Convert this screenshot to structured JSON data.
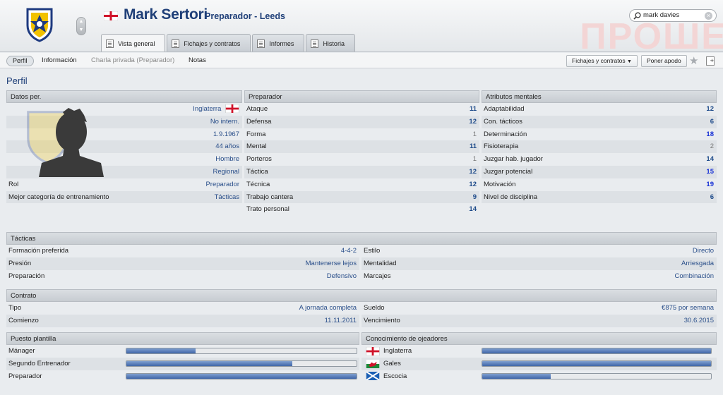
{
  "header": {
    "name": "Mark Sertori",
    "subtitle": "Preparador - Leeds",
    "watermark": "ПРОШЕ",
    "search_value": "mark davies",
    "tabs": [
      {
        "label": "Vista general",
        "active": true
      },
      {
        "label": "Fichajes y contratos",
        "active": false
      },
      {
        "label": "Informes",
        "active": false
      },
      {
        "label": "Historia",
        "active": false
      }
    ]
  },
  "subnav": {
    "items": [
      "Perfil",
      "Información",
      "Charla privada (Preparador)",
      "Notas"
    ],
    "btn_contracts": "Fichajes y contratos",
    "btn_support": "Poner apodo"
  },
  "page_title": "Perfil",
  "personal": {
    "title": "Datos per.",
    "values": [
      "Inglaterra",
      "No intern.",
      "1.9.1967",
      "44 años",
      "Hombre",
      "Regional"
    ],
    "rows": [
      {
        "label": "Rol",
        "value": "Preparador"
      },
      {
        "label": "Mejor categoría de entrenamiento",
        "value": "Tácticas"
      }
    ]
  },
  "coach": {
    "title": "Preparador",
    "rows": [
      {
        "label": "Ataque",
        "value": "11"
      },
      {
        "label": "Defensa",
        "value": "12"
      },
      {
        "label": "Forma",
        "value": "1"
      },
      {
        "label": "Mental",
        "value": "11"
      },
      {
        "label": "Porteros",
        "value": "1"
      },
      {
        "label": "Táctica",
        "value": "12"
      },
      {
        "label": "Técnica",
        "value": "12"
      },
      {
        "label": "Trabajo cantera",
        "value": "9"
      },
      {
        "label": "Trato personal",
        "value": "14"
      }
    ]
  },
  "mental": {
    "title": "Atributos mentales",
    "rows": [
      {
        "label": "Adaptabilidad",
        "value": "12"
      },
      {
        "label": "Con. tácticos",
        "value": "6"
      },
      {
        "label": "Determinación",
        "value": "18"
      },
      {
        "label": "Fisioterapia",
        "value": "2"
      },
      {
        "label": "Juzgar hab. jugador",
        "value": "14"
      },
      {
        "label": "Juzgar potencial",
        "value": "15"
      },
      {
        "label": "Motivación",
        "value": "19"
      },
      {
        "label": "Nivel de disciplina",
        "value": "6"
      }
    ]
  },
  "tactics": {
    "title": "Tácticas",
    "left": [
      {
        "label": "Formación preferida",
        "value": "4-4-2"
      },
      {
        "label": "Presión",
        "value": "Mantenerse lejos"
      },
      {
        "label": "Preparación",
        "value": "Defensivo"
      }
    ],
    "right": [
      {
        "label": "Estilo",
        "value": "Directo"
      },
      {
        "label": "Mentalidad",
        "value": "Arriesgada"
      },
      {
        "label": "Marcajes",
        "value": "Combinación"
      }
    ]
  },
  "contract": {
    "title": "Contrato",
    "left": [
      {
        "label": "Tipo",
        "value": "A jornada completa"
      },
      {
        "label": "Comienzo",
        "value": "11.11.2011"
      }
    ],
    "right": [
      {
        "label": "Sueldo",
        "value": "€875 por semana"
      },
      {
        "label": "Vencimiento",
        "value": "30.6.2015"
      }
    ]
  },
  "squad": {
    "title": "Puesto plantilla",
    "rows": [
      {
        "label": "Mánager",
        "level": 0.3
      },
      {
        "label": "Segundo Entrenador",
        "level": 0.72
      },
      {
        "label": "Preparador",
        "level": 1.0
      }
    ]
  },
  "scouting": {
    "title": "Conocimiento de ojeadores",
    "rows": [
      {
        "label": "Inglaterra",
        "flag": "england-flag",
        "level": 1.0
      },
      {
        "label": "Gales",
        "flag": "wales-flag",
        "level": 1.0
      },
      {
        "label": "Escocia",
        "flag": "scotland-flag",
        "level": 0.3
      }
    ]
  },
  "colors": {
    "title_blue": "#1f3f78",
    "highlight_blue": "#1a33d6",
    "bar_fill": "#3f66a8"
  }
}
